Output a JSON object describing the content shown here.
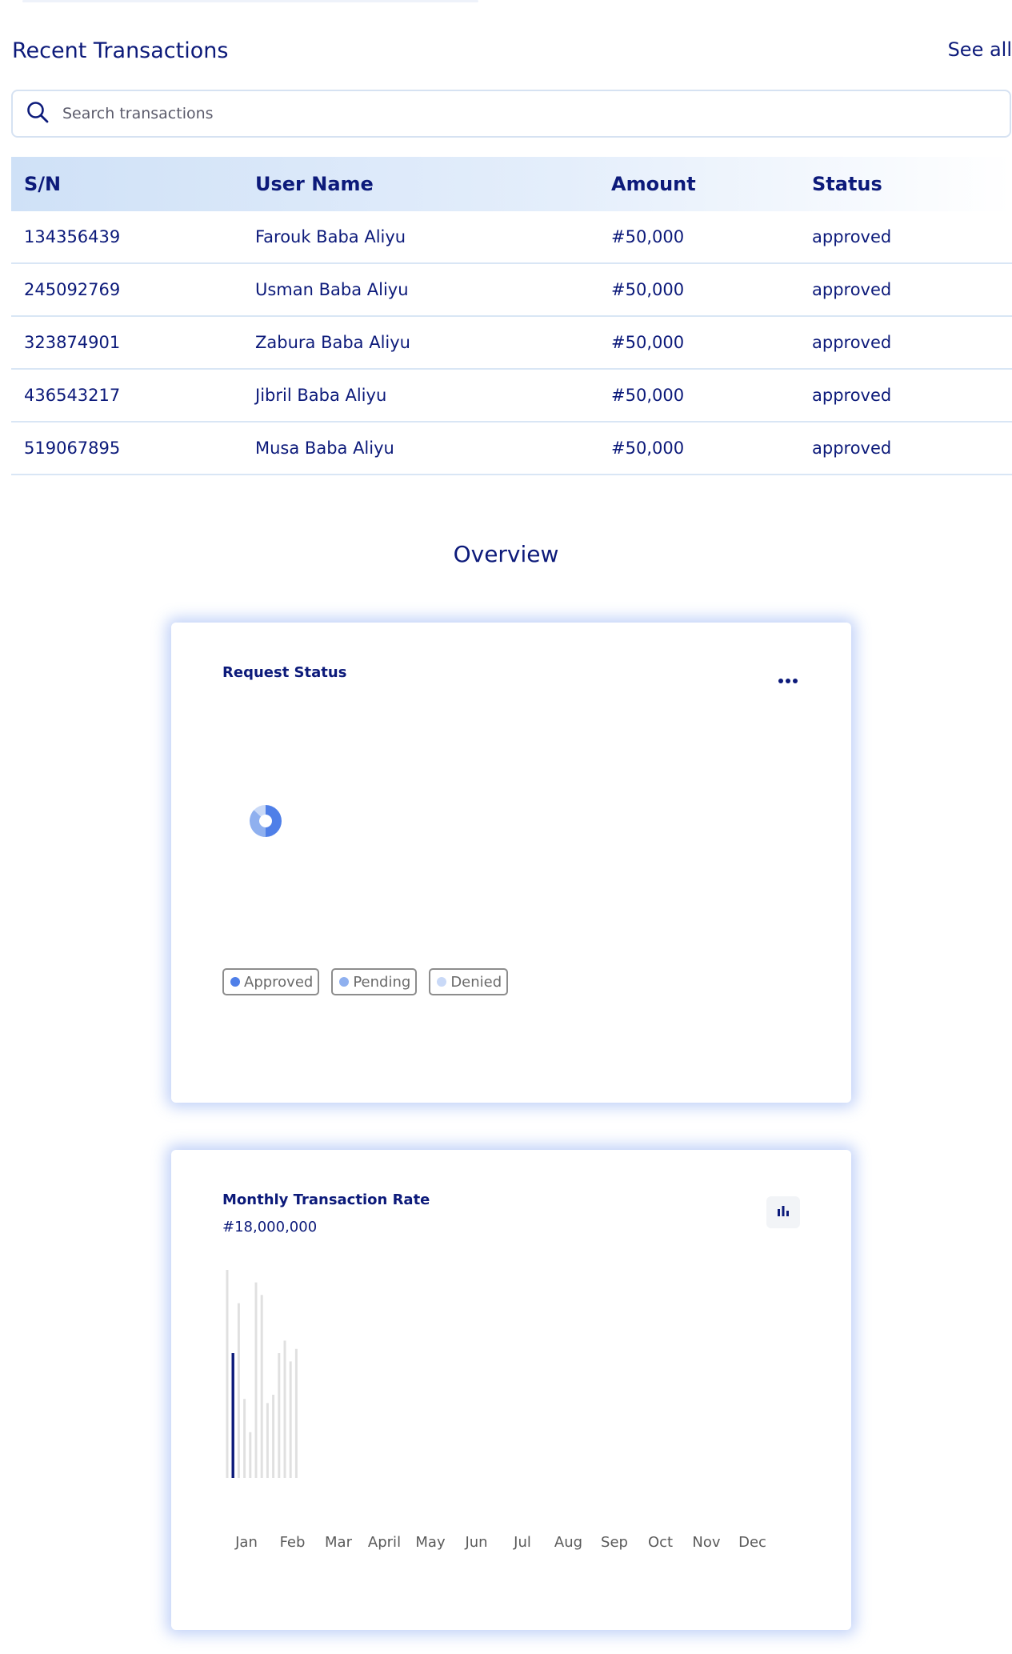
{
  "recent_transactions": {
    "title": "Recent Transactions",
    "see_all_label": "See all",
    "search_placeholder": "Search transactions",
    "columns": [
      "S/N",
      "User Name",
      "Amount",
      "Status"
    ],
    "rows": [
      {
        "sn": "134356439",
        "user": "Farouk Baba Aliyu",
        "amount": "#50,000",
        "status": "approved"
      },
      {
        "sn": "245092769",
        "user": "Usman Baba Aliyu",
        "amount": "#50,000",
        "status": "approved"
      },
      {
        "sn": "323874901",
        "user": "Zabura Baba Aliyu",
        "amount": "#50,000",
        "status": "approved"
      },
      {
        "sn": "436543217",
        "user": "Jibril Baba Aliyu",
        "amount": "#50,000",
        "status": "approved"
      },
      {
        "sn": "519067895",
        "user": "Musa Baba Aliyu",
        "amount": "#50,000",
        "status": "approved"
      }
    ]
  },
  "overview": {
    "title": "Overview",
    "request_status": {
      "title": "Request Status",
      "legend": [
        {
          "label": "Approved",
          "color": "#4f7fe8"
        },
        {
          "label": "Pending",
          "color": "#8fb0ef"
        },
        {
          "label": "Denied",
          "color": "#c9d9f7"
        }
      ]
    },
    "monthly_transaction_rate": {
      "title": "Monthly Transaction Rate",
      "amount": "#18,000,000",
      "highlight_color": "#0c1a7a",
      "bar_color": "#e0e0e0"
    }
  },
  "chart_data": [
    {
      "type": "pie",
      "title": "Request Status",
      "categories": [
        "Approved",
        "Pending",
        "Denied"
      ],
      "values": [
        50,
        37,
        13
      ],
      "colors": [
        "#4f7fe8",
        "#8fb0ef",
        "#c9d9f7"
      ]
    },
    {
      "type": "bar",
      "title": "Monthly Transaction Rate",
      "categories": [
        "Jan",
        "Feb",
        "Mar",
        "April",
        "May",
        "Jun",
        "Jul",
        "Aug",
        "Sep",
        "Oct",
        "Nov",
        "Dec"
      ],
      "bars": [
        100,
        60,
        84,
        38,
        22,
        94,
        88,
        36,
        40,
        60,
        66,
        56,
        62
      ],
      "highlight_index": 1,
      "ylim": [
        0,
        100
      ]
    }
  ]
}
